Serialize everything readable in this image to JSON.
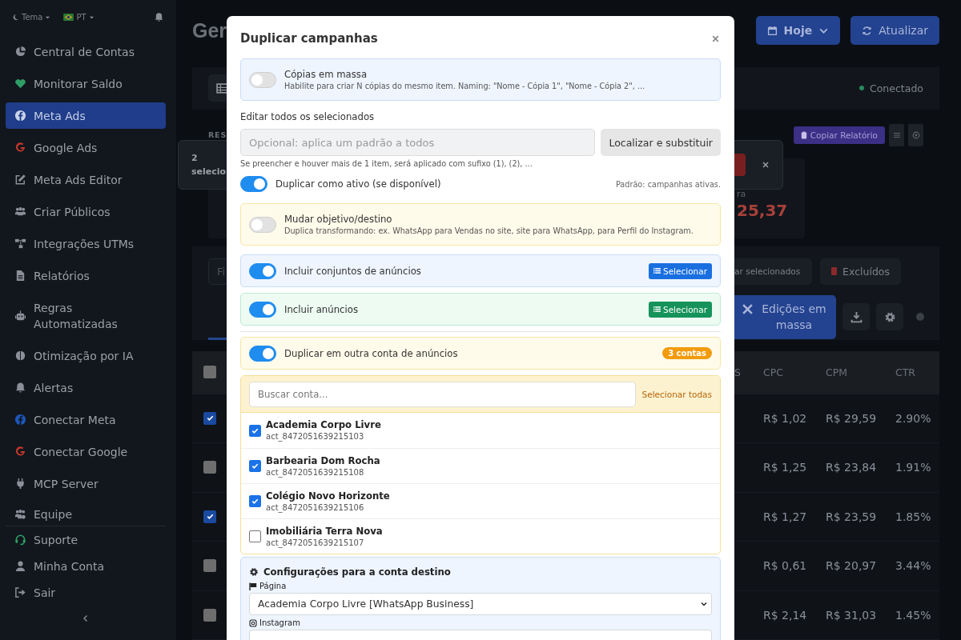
{
  "sidebar": {
    "theme_label": "Tema",
    "language_label": "PT",
    "items": [
      {
        "label": "Central de Contas",
        "selected": false
      },
      {
        "label": "Monitorar Saldo",
        "selected": false
      },
      {
        "label": "Meta Ads",
        "selected": true
      },
      {
        "label": "Google Ads",
        "selected": false
      },
      {
        "label": "Meta Ads Editor",
        "selected": false
      },
      {
        "label": "Criar Públicos",
        "selected": false
      },
      {
        "label": "Integrações UTMs",
        "selected": false
      },
      {
        "label": "Relatórios",
        "selected": false
      },
      {
        "label": "Regras Automatizadas",
        "selected": false
      },
      {
        "label": "Otimização por IA",
        "selected": false
      },
      {
        "label": "Alertas",
        "selected": false
      },
      {
        "label": "Conectar Meta",
        "selected": false
      },
      {
        "label": "Conectar Google",
        "selected": false
      },
      {
        "label": "MCP Server",
        "selected": false
      },
      {
        "label": "Equipe",
        "selected": false
      }
    ],
    "footer_items": [
      {
        "label": "Suporte"
      },
      {
        "label": "Minha Conta"
      },
      {
        "label": "Sair"
      }
    ]
  },
  "page": {
    "title": "Ger",
    "date_button": "Hoje",
    "refresh_button": "Atualizar",
    "status": "Conectado",
    "section_label": "RES",
    "copy_report_button": "Copiar Relatório",
    "toast_text": "2 selecio",
    "card_caption": "ra",
    "card_value": "25,37",
    "filter_placeholder": "Fi",
    "clear_selected_button": "ar selecionados",
    "deleted_button": "Excluídos",
    "bulk_edit_button": "Edições em massa"
  },
  "table": {
    "columns": [
      "S",
      "CPC",
      "CPM",
      "CTR"
    ],
    "header_checked": false,
    "rows": [
      {
        "checked": true,
        "cpc": "R$ 1,02",
        "cpm": "R$ 29,59",
        "ctr": "2.90%"
      },
      {
        "checked": false,
        "cpc": "R$ 1,25",
        "cpm": "R$ 23,84",
        "ctr": "1.91%"
      },
      {
        "checked": true,
        "cpc": "R$ 1,27",
        "cpm": "R$ 23,59",
        "ctr": "1.85%"
      },
      {
        "checked": false,
        "cpc": "R$ 0,61",
        "cpm": "R$ 20,97",
        "ctr": "3.44%"
      },
      {
        "checked": false,
        "cpc": "R$ 2,14",
        "cpm": "R$ 31,03",
        "ctr": "1.45%"
      }
    ]
  },
  "modal": {
    "title": "Duplicar campanhas",
    "bulk_copies": {
      "label": "Cópias em massa",
      "description": "Habilite para criar N cópias do mesmo item. Naming: \"Nome - Cópia 1\", \"Nome - Cópia 2\", ...",
      "on": false
    },
    "edit_all": {
      "label": "Editar todos os selecionados",
      "placeholder": "Opcional: aplica um padrão a todos",
      "button": "Localizar e substituir",
      "hint": "Se preencher e houver mais de 1 item, será aplicado com sufixo (1), (2), ..."
    },
    "duplicate_active": {
      "label": "Duplicar como ativo (se disponível)",
      "on": true,
      "note": "Padrão: campanhas ativas."
    },
    "change_objective": {
      "label": "Mudar objetivo/destino",
      "description": "Duplica transformando: ex. WhatsApp para Vendas no site, site para WhatsApp, para Perfil do Instagram.",
      "on": false
    },
    "include_adsets": {
      "label": "Incluir conjuntos de anúncios",
      "on": true,
      "button": "Selecionar"
    },
    "include_ads": {
      "label": "Incluir anúncios",
      "on": true,
      "button": "Selecionar"
    },
    "other_account": {
      "label": "Duplicar em outra conta de anúncios",
      "on": true,
      "badge": "3 contas"
    },
    "account_picker": {
      "search_placeholder": "Buscar conta...",
      "select_all": "Selecionar todas",
      "accounts": [
        {
          "name": "Academia Corpo Livre",
          "id": "act_8472051639215103",
          "checked": true
        },
        {
          "name": "Barbearia Dom Rocha",
          "id": "act_8472051639215108",
          "checked": true
        },
        {
          "name": "Colégio Novo Horizonte",
          "id": "act_8472051639215106",
          "checked": true
        },
        {
          "name": "Imobiliária Terra Nova",
          "id": "act_8472051639215107",
          "checked": false
        }
      ]
    },
    "target_config": {
      "title": "Configurações para a conta destino",
      "page_label": "Página",
      "page_value": "Academia Corpo Livre [WhatsApp Business]",
      "instagram_label": "Instagram"
    }
  }
}
